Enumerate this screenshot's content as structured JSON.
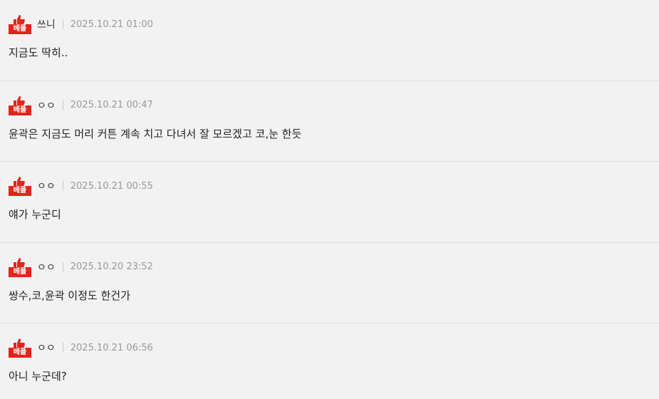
{
  "badge_label": "베플",
  "comments": [
    {
      "author": "쓰니",
      "date": "2025.10.21 01:00",
      "text": "지금도 딱히.."
    },
    {
      "author": "ㅇㅇ",
      "date": "2025.10.21 00:47",
      "text": "윤곽은 지금도 머리 커튼 계속 치고 다녀서 잘 모르겠고 코,눈 한듯"
    },
    {
      "author": "ㅇㅇ",
      "date": "2025.10.21 00:55",
      "text": "얘가 누군디"
    },
    {
      "author": "ㅇㅇ",
      "date": "2025.10.20 23:52",
      "text": "쌍수,코,윤곽 이정도 한건가"
    },
    {
      "author": "ㅇㅇ",
      "date": "2025.10.21 06:56",
      "text": "아니 누군데?"
    }
  ]
}
